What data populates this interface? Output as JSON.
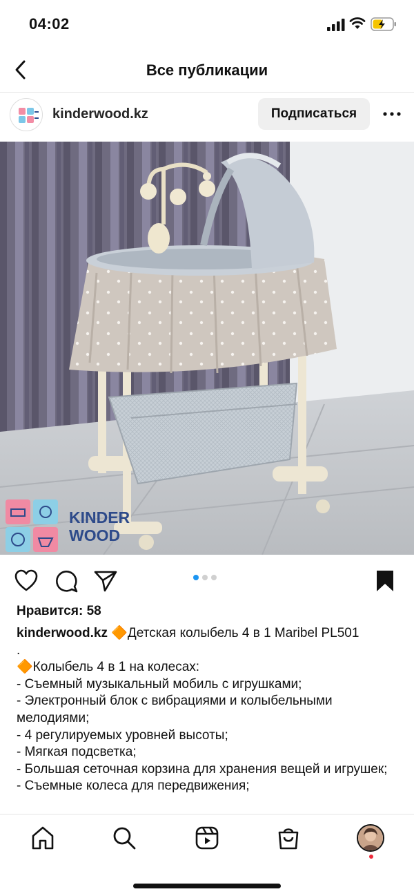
{
  "status_bar": {
    "time": "04:02"
  },
  "nav": {
    "title": "Все публикации"
  },
  "post": {
    "username": "kinderwood.kz",
    "follow_label": "Подписаться",
    "watermark_line1": "KINDER",
    "watermark_line2": "WOOD",
    "carousel": {
      "count": 3,
      "active_index": 0
    },
    "likes": "Нравится: 58",
    "caption": {
      "username": "kinderwood.kz",
      "lines": [
        "🔶Детская колыбель 4 в 1 Maribel PL501",
        " .",
        " 🔶Колыбель 4 в 1 на колесах:",
        " - Съемный музыкальный мобиль с игрушками;",
        " - Электронный блок с вибрациями и колыбельными мелодиями;",
        " - 4 регулируемых уровней высоты;",
        " - Мягкая подсветка;",
        " - Большая сеточная корзина для хранения вещей и игрушек;",
        " - Съемные колеса для передвижения;"
      ]
    }
  },
  "colors": {
    "accent_blue": "#1b95f2",
    "notif_red": "#ed2a3a",
    "follow_bg": "#efefef"
  }
}
